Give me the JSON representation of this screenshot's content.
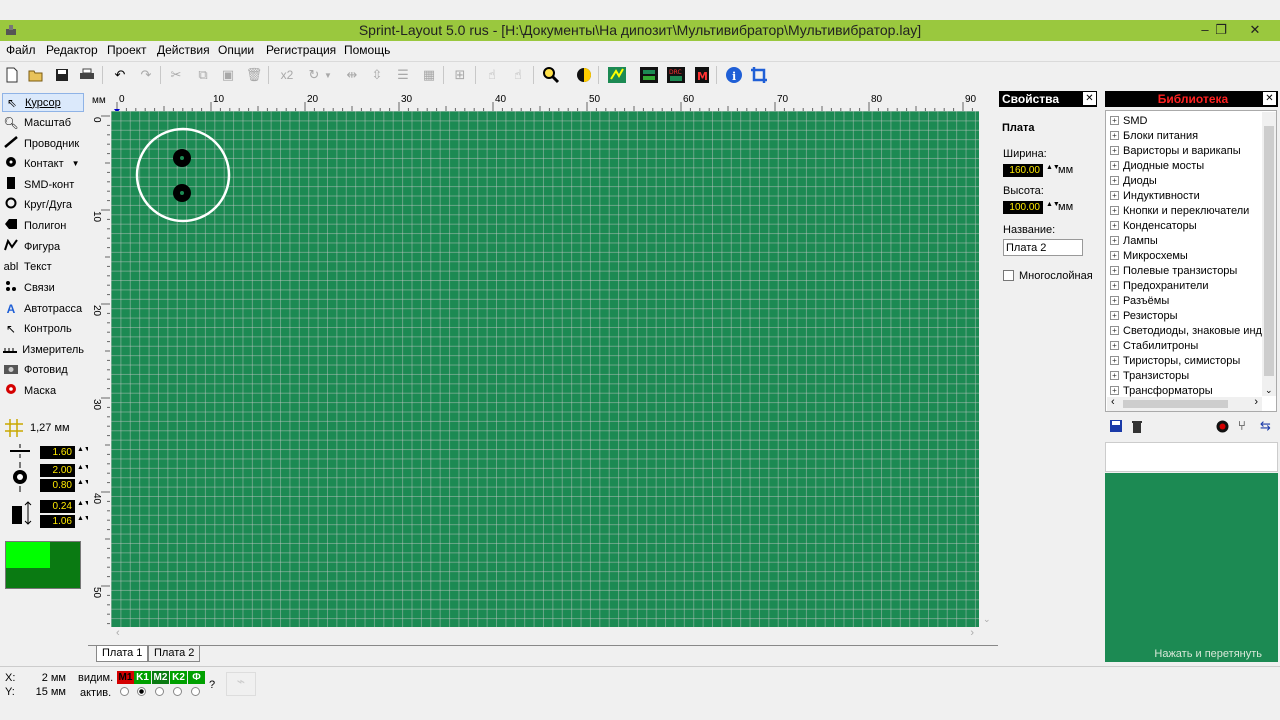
{
  "window": {
    "title": "Sprint-Layout 5.0 rus     - [H:\\Документы\\На дипозит\\Мультивибратор\\Мультивибратор.lay]",
    "min": "–",
    "restore": "❐",
    "close": "✕"
  },
  "menu": [
    "Файл",
    "Редактор",
    "Проект",
    "Действия",
    "Опции",
    "Регистрация",
    "Помощь"
  ],
  "toolbar": {
    "x2_label": "x2",
    "icons": [
      "new-icon",
      "open-icon",
      "save-icon",
      "print-icon",
      "undo-icon",
      "redo-icon",
      "cut-icon",
      "copy-icon",
      "paste-icon",
      "delete-icon",
      "x2-icon",
      "rotate-icon",
      "mirror-h-icon",
      "mirror-v-icon",
      "align-icon",
      "grid-icon",
      "group-icon",
      "lock-icon",
      "unlock-icon",
      "zoom-icon",
      "layer-icon",
      "drc-icon",
      "export-icon",
      "pcb-icon",
      "macro-icon",
      "info-icon",
      "crop-icon"
    ]
  },
  "tools": [
    {
      "label": "Курсор",
      "icon": "cursor-icon"
    },
    {
      "label": "Масштаб",
      "icon": "zoom-icon"
    },
    {
      "label": "Проводник",
      "icon": "track-icon"
    },
    {
      "label": "Контакт",
      "icon": "pad-icon"
    },
    {
      "label": "SMD-конт",
      "icon": "smd-pad-icon"
    },
    {
      "label": "Круг/Дуга",
      "icon": "circle-icon"
    },
    {
      "label": "Полигон",
      "icon": "polygon-icon"
    },
    {
      "label": "Фигура",
      "icon": "shape-icon"
    },
    {
      "label": "Текст",
      "icon": "text-icon"
    },
    {
      "label": "Связи",
      "icon": "connections-icon"
    },
    {
      "label": "Автотрасса",
      "icon": "autoroute-icon"
    },
    {
      "label": "Контроль",
      "icon": "test-icon"
    },
    {
      "label": "Измеритель",
      "icon": "measure-icon"
    },
    {
      "label": "Фотовид",
      "icon": "photoview-icon"
    },
    {
      "label": "Маска",
      "icon": "mask-icon"
    }
  ],
  "tool_text_prefix": "abl",
  "grid": {
    "value": "1,27 мм"
  },
  "sizes": {
    "track": "1.60",
    "pad_outer": "2.00",
    "pad_inner": "0.80",
    "smd_w": "0.24",
    "smd_h": "1.06"
  },
  "colors": {
    "board": "#1c8a53",
    "preview_light": "#00ff00",
    "preview_dark": "#0a7a12",
    "ruler_mark": "#0000cc"
  },
  "ruler": {
    "unit": "мм",
    "top": [
      "0",
      "10",
      "20",
      "30",
      "40",
      "50",
      "60",
      "70",
      "80",
      "90"
    ],
    "left": [
      "0",
      "10",
      "20",
      "30",
      "40",
      "50"
    ]
  },
  "properties": {
    "title": "Свойства",
    "section": "Плата",
    "width_label": "Ширина:",
    "width_value": "160.00",
    "width_unit": "мм",
    "height_label": "Высота:",
    "height_value": "100.00",
    "height_unit": "мм",
    "name_label": "Название:",
    "name_value": "Плата  2",
    "multilayer_label": "Многослойная"
  },
  "library": {
    "title": "Библиотека",
    "items": [
      "SMD",
      "Блоки питания",
      "Варисторы и варикапы",
      "Диодные мосты",
      "Диоды",
      "Индуктивности",
      "Кнопки и переключатели",
      "Конденсаторы",
      "Лампы",
      "Микросхемы",
      "Полевые транзисторы",
      "Предохранители",
      "Разъёмы",
      "Резисторы",
      "Светодиоды, знаковые инди",
      "Стабилитроны",
      "Тиристоры, симисторы",
      "Транзисторы",
      "Трансформаторы"
    ],
    "preview_hint": "Нажать и перетянуть"
  },
  "tabs": [
    "Плата 1",
    "Плата  2"
  ],
  "status": {
    "x_label": "X:",
    "x_value": "2 мм",
    "y_label": "Y:",
    "y_value": "15 мм",
    "visible_label": "видим.",
    "active_label": "актив.",
    "layers": [
      {
        "name": "M1",
        "color": "#d40000"
      },
      {
        "name": "K1",
        "color": "#00a000"
      },
      {
        "name": "M2",
        "color": "#0a7a12"
      },
      {
        "name": "K2",
        "color": "#00a000"
      },
      {
        "name": "Ф",
        "color": "#00a000"
      }
    ],
    "help": "?"
  }
}
